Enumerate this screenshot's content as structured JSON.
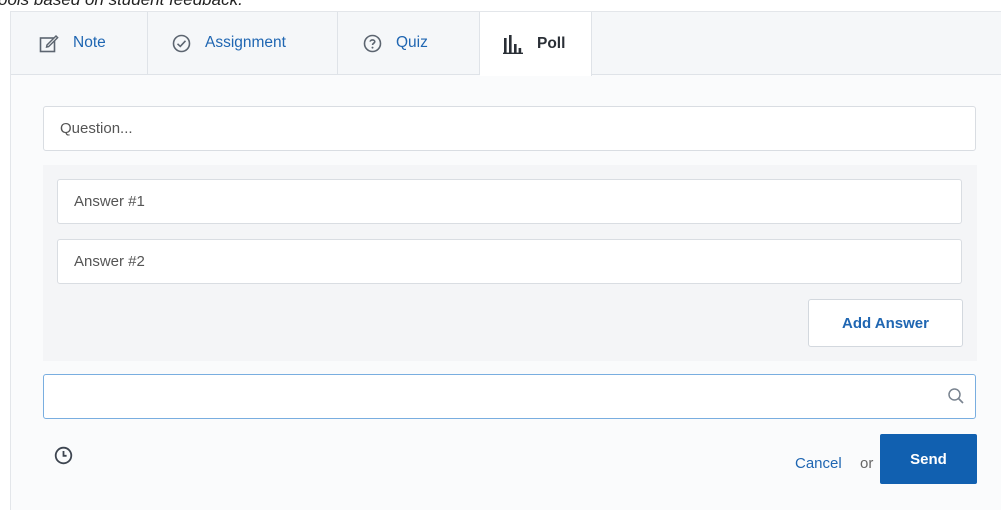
{
  "header_fragment": "ools based on student feedback.",
  "tabs": [
    {
      "label": "Note",
      "icon": "edit-note-icon"
    },
    {
      "label": "Assignment",
      "icon": "check-circle-icon"
    },
    {
      "label": "Quiz",
      "icon": "question-circle-icon"
    },
    {
      "label": "Poll",
      "icon": "bar-chart-icon"
    }
  ],
  "active_tab": "Poll",
  "poll": {
    "question_placeholder": "Question...",
    "answers": [
      {
        "placeholder": "Answer #1"
      },
      {
        "placeholder": "Answer #2"
      }
    ],
    "add_answer_label": "Add Answer"
  },
  "search": {
    "value": "",
    "icon": "search-icon"
  },
  "footer": {
    "schedule_icon": "clock-icon",
    "cancel_label": "Cancel",
    "or_label": "or",
    "send_label": "Send"
  },
  "colors": {
    "link": "#1f66b2",
    "send_bg": "#1160b0",
    "focus_border": "#79aee0"
  }
}
